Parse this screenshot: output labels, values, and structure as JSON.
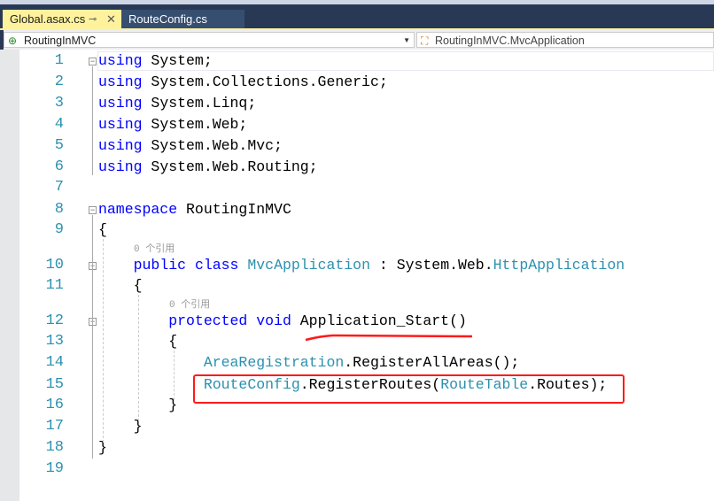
{
  "tabs": [
    {
      "label": "Global.asax.cs",
      "active": true,
      "pin": "⊸",
      "close": "✕"
    },
    {
      "label": "RouteConfig.cs",
      "active": false
    }
  ],
  "nav": {
    "project": "RoutingInMVC",
    "class": "RoutingInMVC.MvcApplication"
  },
  "codelens": "0 个引用",
  "lines": [
    [
      [
        "using",
        "kw"
      ],
      [
        " System;",
        ""
      ]
    ],
    [
      [
        "using",
        "kw"
      ],
      [
        " System.Collections.Generic;",
        ""
      ]
    ],
    [
      [
        "using",
        "kw"
      ],
      [
        " System.Linq;",
        ""
      ]
    ],
    [
      [
        "using",
        "kw"
      ],
      [
        " System.Web;",
        ""
      ]
    ],
    [
      [
        "using",
        "kw"
      ],
      [
        " System.Web.Mvc;",
        ""
      ]
    ],
    [
      [
        "using",
        "kw"
      ],
      [
        " System.Web.Routing;",
        ""
      ]
    ],
    [],
    [
      [
        "namespace",
        "kw"
      ],
      [
        " RoutingInMVC",
        ""
      ]
    ],
    [
      [
        "{",
        ""
      ]
    ],
    [
      [
        "    ",
        ""
      ],
      [
        "public",
        "kw"
      ],
      [
        " ",
        ""
      ],
      [
        "class",
        "kw"
      ],
      [
        " ",
        ""
      ],
      [
        "MvcApplication",
        "ty"
      ],
      [
        " : System.Web.",
        ""
      ],
      [
        "HttpApplication",
        "ty"
      ]
    ],
    [
      [
        "    {",
        ""
      ]
    ],
    [
      [
        "        ",
        ""
      ],
      [
        "protected",
        "kw"
      ],
      [
        " ",
        ""
      ],
      [
        "void",
        "kw"
      ],
      [
        " Application_Start()",
        ""
      ]
    ],
    [
      [
        "        {",
        ""
      ]
    ],
    [
      [
        "            ",
        ""
      ],
      [
        "AreaRegistration",
        "ty"
      ],
      [
        ".RegisterAllAreas();",
        ""
      ]
    ],
    [
      [
        "            ",
        ""
      ],
      [
        "RouteConfig",
        "ty"
      ],
      [
        ".RegisterRoutes(",
        ""
      ],
      [
        "RouteTable",
        "ty"
      ],
      [
        ".Routes);",
        ""
      ]
    ],
    [
      [
        "        }",
        ""
      ]
    ],
    [
      [
        "    }",
        ""
      ]
    ],
    [
      [
        "}",
        ""
      ]
    ],
    []
  ]
}
